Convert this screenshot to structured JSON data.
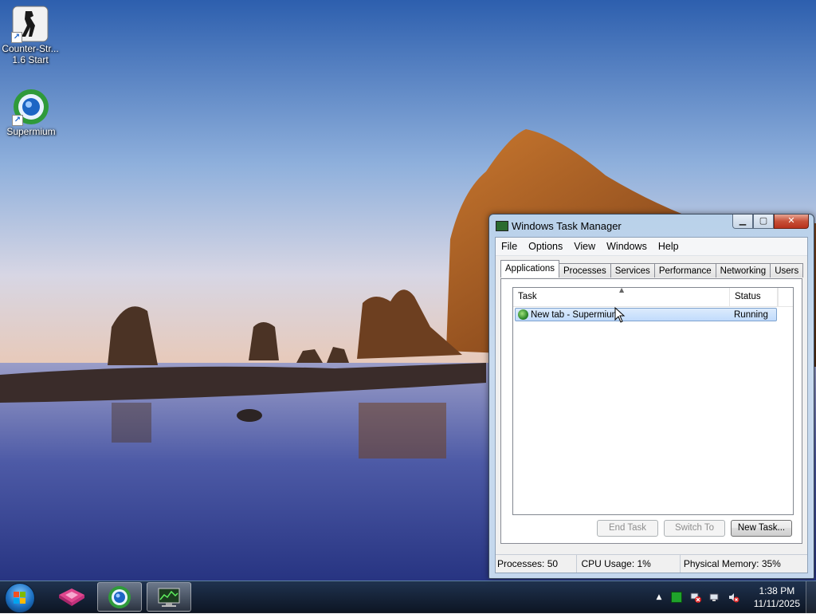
{
  "desktop": {
    "icons": [
      {
        "label": "Counter-Str...\n1.6 Start",
        "line1": "Counter-Str...",
        "line2": "1.6 Start",
        "icon": "counter-strike-icon"
      },
      {
        "label": "Supermium",
        "icon": "supermium-icon"
      }
    ]
  },
  "task_manager": {
    "title": "Windows Task Manager",
    "menu": [
      "File",
      "Options",
      "View",
      "Windows",
      "Help"
    ],
    "tabs": [
      "Applications",
      "Processes",
      "Services",
      "Performance",
      "Networking",
      "Users"
    ],
    "active_tab": "Applications",
    "columns": {
      "task": "Task",
      "status": "Status"
    },
    "rows": [
      {
        "task": "New tab - Supermium",
        "status": "Running",
        "icon": "supermium-icon"
      }
    ],
    "buttons": {
      "end_task": "End Task",
      "switch_to": "Switch To",
      "new_task": "New Task..."
    },
    "status": {
      "processes": "Processes: 50",
      "cpu": "CPU Usage: 1%",
      "memory": "Physical Memory: 35%"
    }
  },
  "taskbar": {
    "pinned": [
      "start-button",
      "vmware-icon",
      "supermium-icon",
      "task-manager-icon"
    ],
    "clock": {
      "time": "1:38 PM",
      "date": "11/11/2025"
    },
    "tray_icons": [
      "show-hidden-icons-arrow",
      "green-status-icon",
      "network-error-icon",
      "network-icon",
      "volume-muted-icon"
    ]
  },
  "colors": {
    "title_bar": "#c4d7ed",
    "selection": "#c1dbfc",
    "close_button": "#c74f37",
    "taskbar": "#1e3246"
  }
}
